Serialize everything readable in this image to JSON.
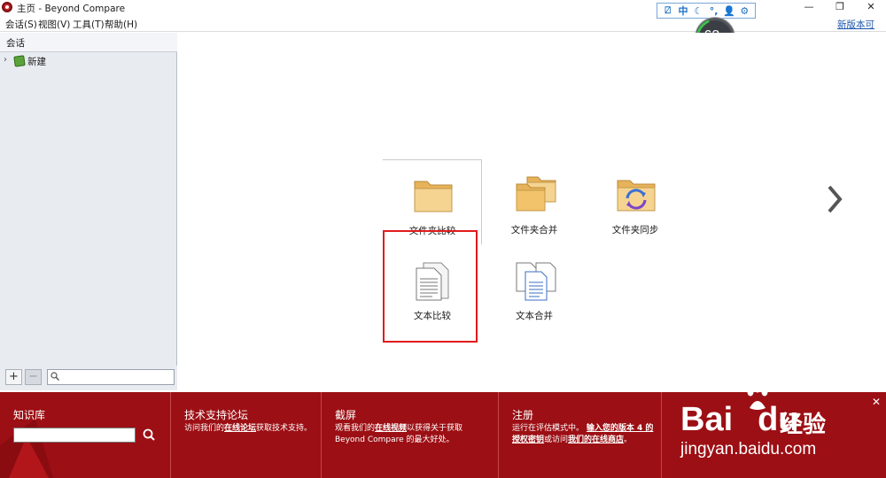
{
  "window": {
    "title": "主页 - Beyond Compare",
    "minimize_icon": "minimize-icon",
    "maximize_icon": "restore-icon",
    "close_icon": "close-icon",
    "minimize_glyph": "—",
    "restore_glyph": "❐",
    "close_glyph": "✕"
  },
  "ime_toolbar": {
    "items": [
      "⍁",
      "中",
      "☾",
      "°,",
      "👤",
      "⚙"
    ]
  },
  "gauge": {
    "value": "63",
    "unit": "%"
  },
  "menu": {
    "items": [
      "会话(S)",
      "视图(V)",
      "工具(T)",
      "帮助(H)"
    ],
    "update_link": "新版本可用..."
  },
  "sidebar": {
    "header": "会话",
    "tree": [
      {
        "label": "新建",
        "expand_glyph": "›"
      }
    ],
    "add_label": "+",
    "remove_label": "−",
    "search_value": ""
  },
  "main": {
    "tiles": [
      {
        "label": "文件夹比较",
        "icon": "folder-icon"
      },
      {
        "label": "文件夹合并",
        "icon": "folders-icon"
      },
      {
        "label": "文件夹同步",
        "icon": "folder-sync-icon"
      },
      {
        "label": "文本比较",
        "icon": "text-compare-icon"
      },
      {
        "label": "文本合并",
        "icon": "text-merge-icon"
      }
    ],
    "next_icon": "chevron-right-icon"
  },
  "footer": {
    "kb": {
      "title": "知识库",
      "input_value": ""
    },
    "support": {
      "title": "技术支持论坛",
      "text_pre": "访问我们的",
      "link": "在线论坛",
      "text_post": "获取技术支持。"
    },
    "screencast": {
      "title": "截屏",
      "text_pre": "观看我们的",
      "link": "在线视频",
      "text_post": "以获得关于获取 Beyond Compare 的最大好处。"
    },
    "register": {
      "title": "注册",
      "text_pre": "运行在评估模式中。",
      "link1": "输入您的版本 4 的授权密钥",
      "text_mid": "或访问",
      "link2": "我们的在线商店",
      "text_post": "。"
    },
    "close_glyph": "✕",
    "watermark": {
      "brand": "Bai",
      "brand_tail": "du",
      "brand_cn": "经验",
      "url": "jingyan.baidu.com"
    }
  },
  "colors": {
    "footer_bg": "#9c0f14",
    "highlight": "#e11b1b",
    "link": "#1a55b0",
    "folder": "#f2c36b"
  }
}
